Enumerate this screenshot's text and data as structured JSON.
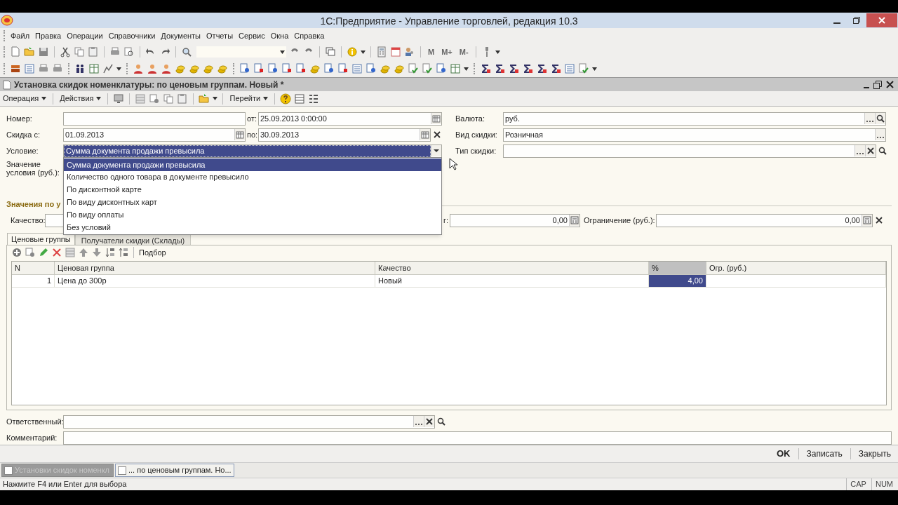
{
  "window": {
    "title": "1С:Предприятие - Управление торговлей, редакция 10.3"
  },
  "menu": [
    "Файл",
    "Правка",
    "Операции",
    "Справочники",
    "Документы",
    "Отчеты",
    "Сервис",
    "Окна",
    "Справка"
  ],
  "toolbar_text_buttons": [
    "M",
    "M+",
    "M-"
  ],
  "document": {
    "title": "Установка скидок номенклатуры: по ценовым группам. Новый *",
    "actions": [
      "Операция",
      "Действия"
    ],
    "goto": "Перейти",
    "fields": {
      "number": {
        "label": "Номер:"
      },
      "date_from_label": "от:",
      "date": "25.09.2013  0:00:00",
      "discount_from": {
        "label": "Скидка с:",
        "value": "01.09.2013"
      },
      "to_label": "по:",
      "discount_to": "30.09.2013",
      "currency": {
        "label": "Валюта:",
        "value": "руб."
      },
      "discount_kind": {
        "label": "Вид скидки:",
        "value": "Розничная"
      },
      "discount_type": {
        "label": "Тип скидки:"
      },
      "condition": {
        "label": "Условие:",
        "value": "Сумма документа продажи превысила",
        "expanded": true
      },
      "condition_value": {
        "label": "Значение\nусловия (руб.):"
      }
    },
    "condition_options": [
      {
        "label": "Сумма документа продажи превысила",
        "selected": true
      },
      {
        "label": "Количество одного товара в документе превысило",
        "selected": false
      },
      {
        "label": "По дисконтной карте",
        "selected": false
      },
      {
        "label": "По виду дисконтных карт",
        "selected": false
      },
      {
        "label": "По виду оплаты",
        "selected": false
      },
      {
        "label": "Без условий",
        "selected": false
      }
    ],
    "section_title": "Значения по у",
    "quality_label": "Качество:",
    "percent_label_tail": "г:",
    "percent_value": "0,00",
    "limit": {
      "label": "Ограничение (руб.):",
      "value": "0,00"
    },
    "tabs": [
      {
        "label": "Ценовые группы",
        "selected": true
      },
      {
        "label": "Получатели скидки (Склады)",
        "selected": false
      }
    ],
    "table_pick": "Подбор",
    "table": {
      "columns": [
        "N",
        "Ценовая группа",
        "Качество",
        "%",
        "Огр. (руб.)"
      ],
      "rows": [
        {
          "cells": [
            {
              "text": "1",
              "selected": false
            },
            {
              "text": "Цена до 300р",
              "selected": false
            },
            {
              "text": "Новый",
              "selected": false
            },
            {
              "text": "4,00",
              "selected": true
            },
            {
              "selected": false
            }
          ]
        }
      ]
    },
    "responsible": {
      "label": "Ответственный:"
    },
    "comment": {
      "label": "Комментарий:"
    },
    "buttons": [
      {
        "label": "OK",
        "default": true
      },
      {
        "label": "Записать",
        "default": false
      },
      {
        "label": "Закрыть",
        "default": false
      }
    ]
  },
  "taskbar": [
    {
      "label": "Установки скидок номенкл",
      "selected": false
    },
    {
      "label": "... по ценовым группам. Но...",
      "selected": true
    }
  ],
  "status_bar": {
    "hint": "Нажмите F4 или Enter для выбора",
    "indicators": [
      "CAP",
      "NUM"
    ]
  }
}
